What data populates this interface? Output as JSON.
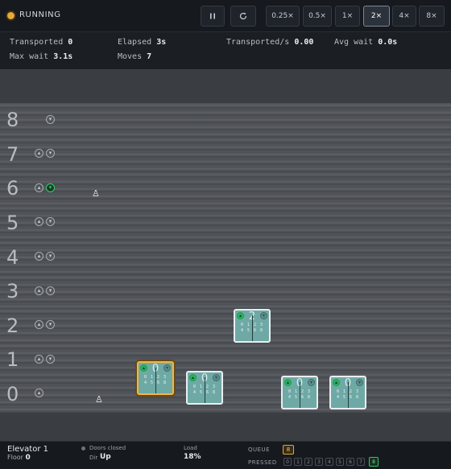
{
  "status": {
    "label": "RUNNING",
    "color": "#e8a93a"
  },
  "controls": {
    "pause_icon": "pause-icon",
    "reset_icon": "reset-icon",
    "speeds": [
      "0.25×",
      "0.5×",
      "1×",
      "2×",
      "4×",
      "8×"
    ],
    "active_speed": "2×"
  },
  "stats": {
    "transported_label": "Transported",
    "transported": "0",
    "elapsed_label": "Elapsed",
    "elapsed": "3s",
    "rate_label": "Transported/s",
    "rate": "0.00",
    "avg_wait_label": "Avg wait",
    "avg_wait": "0.0s",
    "max_wait_label": "Max wait",
    "max_wait": "3.1s",
    "moves_label": "Moves",
    "moves": "7"
  },
  "floors": [
    "8",
    "7",
    "6",
    "5",
    "4",
    "3",
    "2",
    "1",
    "0"
  ],
  "cars": [
    {
      "floor": "0",
      "pads": "0 1 2 3 4 5 6 8",
      "selected": true
    },
    {
      "floor": "0",
      "pads": "0 1 2 3 4 5 6 8",
      "selected": false
    },
    {
      "floor": "2",
      "pads": "0 1 2 3 4 5 6 8",
      "selected": false
    },
    {
      "floor": "0",
      "pads": "0 1 2 3 4 5 6 8",
      "selected": false
    },
    {
      "floor": "0",
      "pads": "0 1 2 3 4 5 6 8",
      "selected": false
    }
  ],
  "selected": {
    "title": "Elevator 1",
    "floor_label": "Floor",
    "floor": "0",
    "doors": "Doors closed",
    "dir_label": "Dir",
    "dir": "Up",
    "load_label": "Load",
    "load": "18%",
    "queue_label": "QUEUE",
    "queue": [
      "8"
    ],
    "pressed_label": "PRESSED",
    "pressed_floors": [
      "0",
      "1",
      "2",
      "3",
      "4",
      "5",
      "6",
      "7",
      "8"
    ],
    "pressed_active": [
      "8"
    ]
  }
}
